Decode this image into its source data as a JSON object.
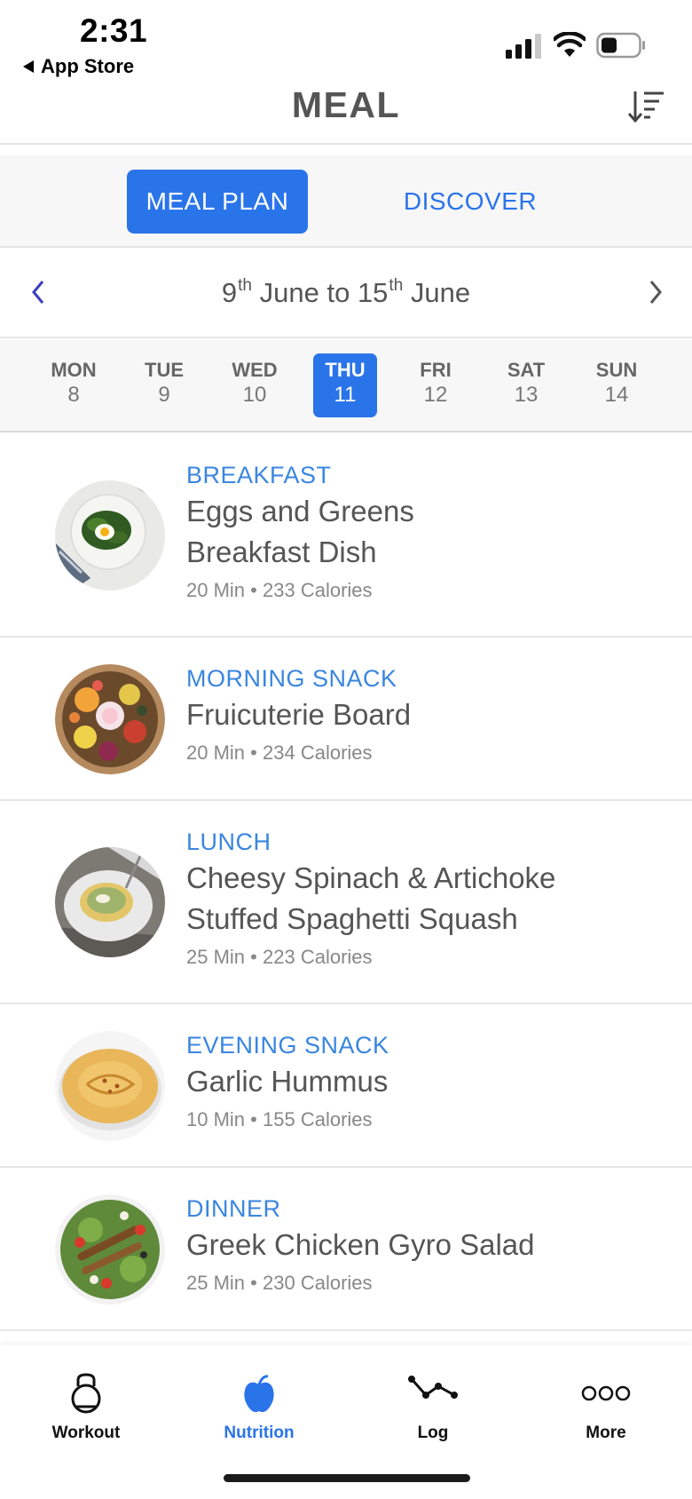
{
  "status": {
    "time": "2:31",
    "back_label": "App Store"
  },
  "header": {
    "title": "MEAL"
  },
  "segments": {
    "active": "MEAL PLAN",
    "inactive": "DISCOVER"
  },
  "week": {
    "start_day": "9",
    "start_suffix": "th",
    "start_month": "June",
    "connector": "to",
    "end_day": "15",
    "end_suffix": "th",
    "end_month": "June"
  },
  "days": [
    {
      "name": "MON",
      "num": "8"
    },
    {
      "name": "TUE",
      "num": "9"
    },
    {
      "name": "WED",
      "num": "10"
    },
    {
      "name": "THU",
      "num": "11"
    },
    {
      "name": "FRI",
      "num": "12"
    },
    {
      "name": "SAT",
      "num": "13"
    },
    {
      "name": "SUN",
      "num": "14"
    }
  ],
  "meals": [
    {
      "type": "BREAKFAST",
      "name_line1": "Eggs and Greens",
      "name_line2": "Breakfast Dish",
      "time": "20 Min",
      "calories": "233 Calories"
    },
    {
      "type": "MORNING SNACK",
      "name_line1": "Fruicuterie Board",
      "name_line2": "",
      "time": "20 Min",
      "calories": "234 Calories"
    },
    {
      "type": "LUNCH",
      "name_line1": "Cheesy Spinach & Artichoke",
      "name_line2": "Stuffed Spaghetti Squash",
      "time": "25 Min",
      "calories": "223 Calories"
    },
    {
      "type": "EVENING SNACK",
      "name_line1": "Garlic Hummus",
      "name_line2": "",
      "time": "10 Min",
      "calories": "155 Calories"
    },
    {
      "type": "DINNER",
      "name_line1": "Greek Chicken Gyro Salad",
      "name_line2": "",
      "time": "25 Min",
      "calories": "230 Calories"
    }
  ],
  "meta_separator": "•",
  "tabs": [
    {
      "label": "Workout",
      "icon": "kettlebell-icon"
    },
    {
      "label": "Nutrition",
      "icon": "apple-icon"
    },
    {
      "label": "Log",
      "icon": "graph-icon"
    },
    {
      "label": "More",
      "icon": "more-icon"
    }
  ],
  "colors": {
    "accent": "#2a74ea",
    "meal_type": "#3a86e0",
    "text": "#555555"
  }
}
